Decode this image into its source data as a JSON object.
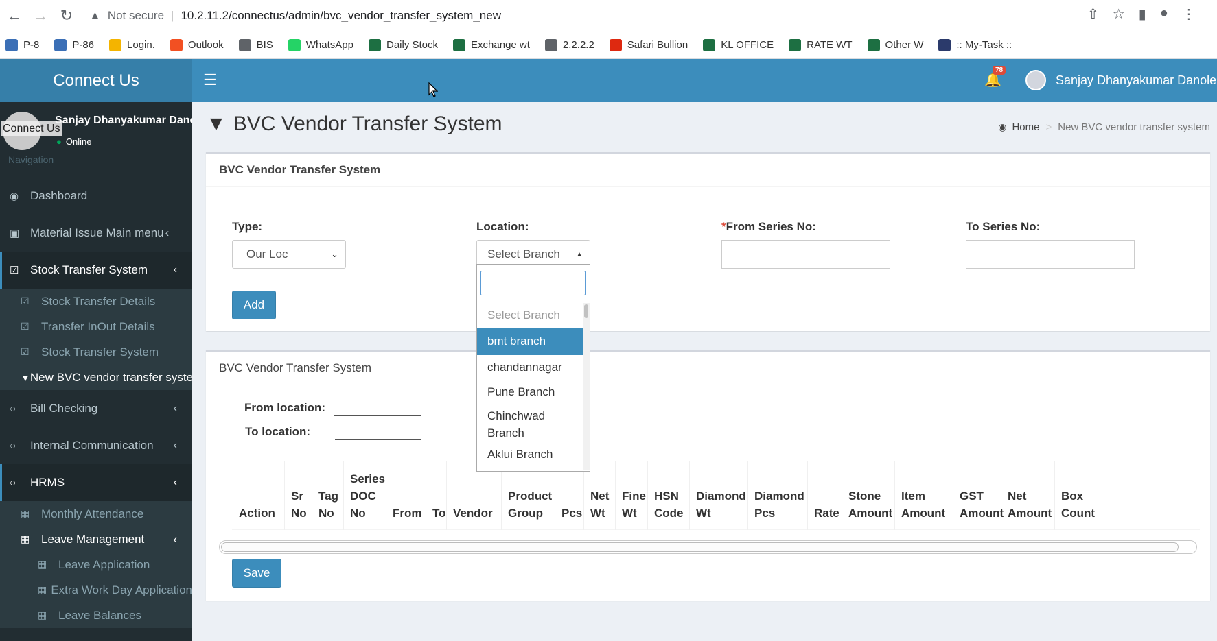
{
  "browser": {
    "not_secure": "Not secure",
    "url": "10.2.11.2/connectus/admin/bvc_vendor_transfer_system_new",
    "bookmarks": [
      {
        "label": "P-8",
        "color": "#3b6fb6"
      },
      {
        "label": "P-86",
        "color": "#3b6fb6"
      },
      {
        "label": "Login.",
        "color": "#f4b400"
      },
      {
        "label": "Outlook",
        "color": "#f25022"
      },
      {
        "label": "BIS",
        "color": "#5f6368"
      },
      {
        "label": "WhatsApp",
        "color": "#25d366"
      },
      {
        "label": "Daily Stock",
        "color": "#1d6f42"
      },
      {
        "label": "Exchange wt",
        "color": "#1d6f42"
      },
      {
        "label": "2.2.2.2",
        "color": "#5f6368"
      },
      {
        "label": "Safari Bullion",
        "color": "#de2910"
      },
      {
        "label": "KL OFFICE",
        "color": "#1d6f42"
      },
      {
        "label": "RATE WT",
        "color": "#1d6f42"
      },
      {
        "label": "Other W",
        "color": "#1d6f42"
      },
      {
        "label": ":: My-Task ::",
        "color": "#2b3a6b"
      }
    ]
  },
  "header": {
    "logo": "Connect Us",
    "notifications": "78",
    "user": "Sanjay Dhanyakumar Danole"
  },
  "sidebar": {
    "user_name": "Sanjay Dhanyakumar Danole",
    "status": "Online",
    "tooltip": "Connect Us",
    "nav_header": "Navigation",
    "items": [
      {
        "label": "Dashboard",
        "icon": "dashboard-icon"
      },
      {
        "label": "Material Issue Main menu",
        "icon": "camera-icon"
      },
      {
        "label": "Stock Transfer System",
        "icon": "checkbox-icon"
      },
      {
        "label": "Bill Checking",
        "icon": "circle-icon"
      },
      {
        "label": "Internal Communication",
        "icon": "circle-icon"
      },
      {
        "label": "HRMS",
        "icon": "circle-icon"
      }
    ],
    "stock_sub": [
      "Stock Transfer Details",
      "Transfer InOut Details",
      "Stock Transfer System",
      "New BVC vendor transfer system"
    ],
    "hrms_sub": [
      "Monthly Attendance",
      "Leave Management"
    ],
    "leave_sub": [
      "Leave Application",
      "Extra Work Day Application",
      "Leave Balances"
    ]
  },
  "page": {
    "title": "BVC Vendor Transfer System",
    "breadcrumb_home": "Home",
    "breadcrumb_current": "New BVC vendor transfer system"
  },
  "form": {
    "box_title": "BVC Vendor Transfer System",
    "type_label": "Type:",
    "type_value": "Our Loc",
    "location_label": "Location:",
    "location_value": "Select Branch",
    "from_series_label": "From Series No:",
    "to_series_label": "To Series No:",
    "add_button": "Add"
  },
  "dropdown": {
    "options": [
      "Select Branch",
      "bmt branch",
      "chandannagar",
      "Pune Branch",
      "Chinchwad Branch",
      "Aklui Branch"
    ],
    "highlighted": "bmt branch"
  },
  "grid": {
    "box_title": "BVC Vendor Transfer System",
    "from_location_label": "From location:",
    "to_location_label": "To location:",
    "columns": [
      "Action",
      "Sr No",
      "Tag No",
      "Series DOC No",
      "From",
      "To",
      "Vendor",
      "Product Group",
      "Pcs",
      "Net Wt",
      "Fine Wt",
      "HSN Code",
      "Diamond Wt",
      "Diamond Pcs",
      "Rate",
      "Stone Amount",
      "Item Amount",
      "GST Amount",
      "Net Amount",
      "Box Count"
    ],
    "save_button": "Save"
  }
}
